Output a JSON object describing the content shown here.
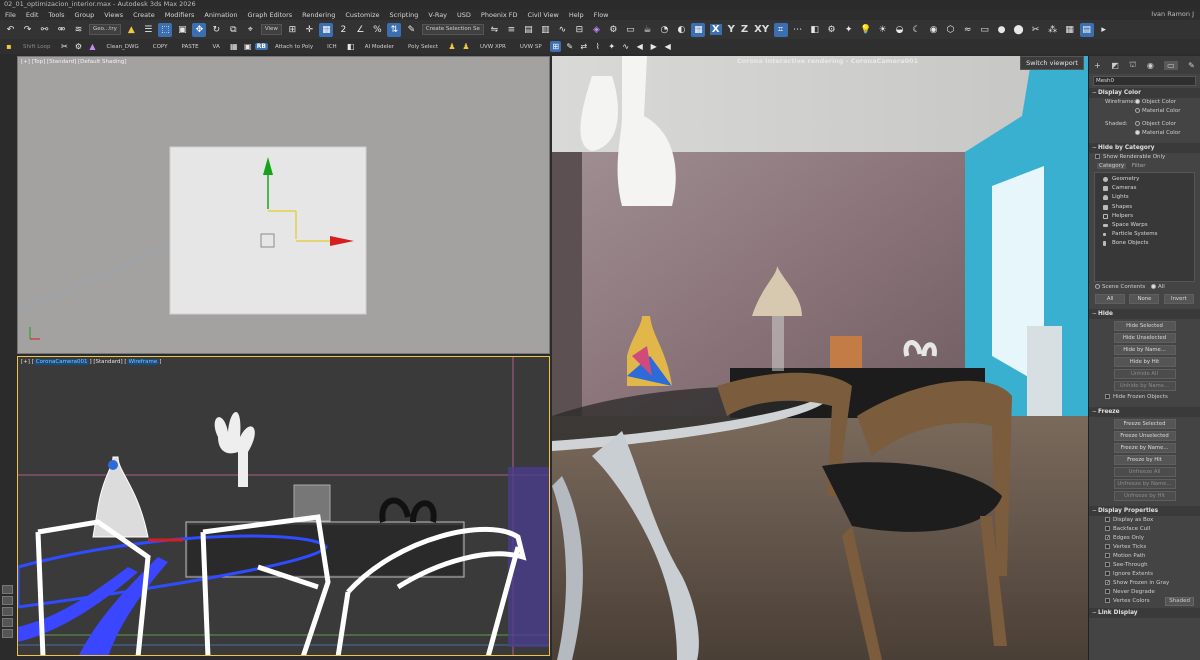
{
  "window": {
    "title": "02_01_optimizacion_interior.max - Autodesk 3ds Max 2026",
    "user": "Ivan Ramon J"
  },
  "menu": [
    "File",
    "Edit",
    "Tools",
    "Group",
    "Views",
    "Create",
    "Modifiers",
    "Animation",
    "Graph Editors",
    "Rendering",
    "Customize",
    "Scripting",
    "V-Ray",
    "USD",
    "Phoenix FD",
    "Civil View",
    "Help",
    "Flow"
  ],
  "toolbar1": {
    "selection_filter": "Geo...try",
    "ref_coord": "View",
    "selection_set": "Create Selection Se",
    "axes": [
      "X",
      "Y",
      "Z",
      "XY"
    ]
  },
  "toolbar2": {
    "shift_loop": "Shift Loop",
    "clean_dwg": "Clean_DWG",
    "copy": "COPY",
    "paste": "PASTE",
    "va": "VA",
    "rb": "RB",
    "attach_to_poly": "Attach to Poly",
    "ich": "ICH",
    "ai_modeler": "AI Modeler",
    "poly_select": "Poly Select",
    "uvw_xpr": "UVW XPR",
    "uvw_sp": "UVW SP"
  },
  "viewports": {
    "top_label": "[+] [Top] [Standard] [Default Shading]",
    "camera_label_prefix": "[+] [",
    "camera_name": "CoronaCamera001",
    "camera_label_mid": "] [Standard] [",
    "camera_mode": "Wireframe",
    "camera_label_suffix": "]",
    "render_title": "Corona Interactive rendering - CoronaCamera001",
    "switch_viewport": "Switch viewport"
  },
  "command_panel": {
    "object_name": "Mesh0",
    "display_color": {
      "title": "Display Color",
      "wireframe_label": "Wireframe:",
      "shaded_label": "Shaded:",
      "object_color": "Object Color",
      "material_color": "Material Color"
    },
    "hide_by_category": {
      "title": "Hide by Category",
      "show_renderable_only": "Show Renderable Only",
      "tab_category": "Category",
      "tab_filter": "Filter",
      "items": [
        "Geometry",
        "Cameras",
        "Lights",
        "Shapes",
        "Helpers",
        "Space Warps",
        "Particle Systems",
        "Bone Objects"
      ],
      "scene_contents": "Scene Contents",
      "all_radio": "All",
      "btn_all": "All",
      "btn_none": "None",
      "btn_invert": "Invert"
    },
    "hide": {
      "title": "Hide",
      "buttons": [
        "Hide Selected",
        "Hide Unselected",
        "Hide by Name...",
        "Hide by Hit",
        "Unhide All",
        "Unhide by Name...",
        "Hide Frozen Objects"
      ]
    },
    "freeze": {
      "title": "Freeze",
      "buttons": [
        "Freeze Selected",
        "Freeze Unselected",
        "Freeze by Name...",
        "Freeze by Hit",
        "Unfreeze All",
        "Unfreeze by Name...",
        "Unfreeze by Hit"
      ]
    },
    "display_properties": {
      "title": "Display Properties",
      "items": [
        "Display as Box",
        "Backface Cull",
        "Edges Only",
        "Vertex Ticks",
        "Motion Path",
        "See-Through",
        "Ignore Extents",
        "Show Frozen in Gray",
        "Never Degrade",
        "Vertex Colors"
      ],
      "checked": [
        false,
        false,
        true,
        false,
        false,
        false,
        false,
        true,
        false,
        false
      ],
      "shaded_btn": "Shaded"
    },
    "link_display": {
      "title": "Link Display"
    }
  }
}
